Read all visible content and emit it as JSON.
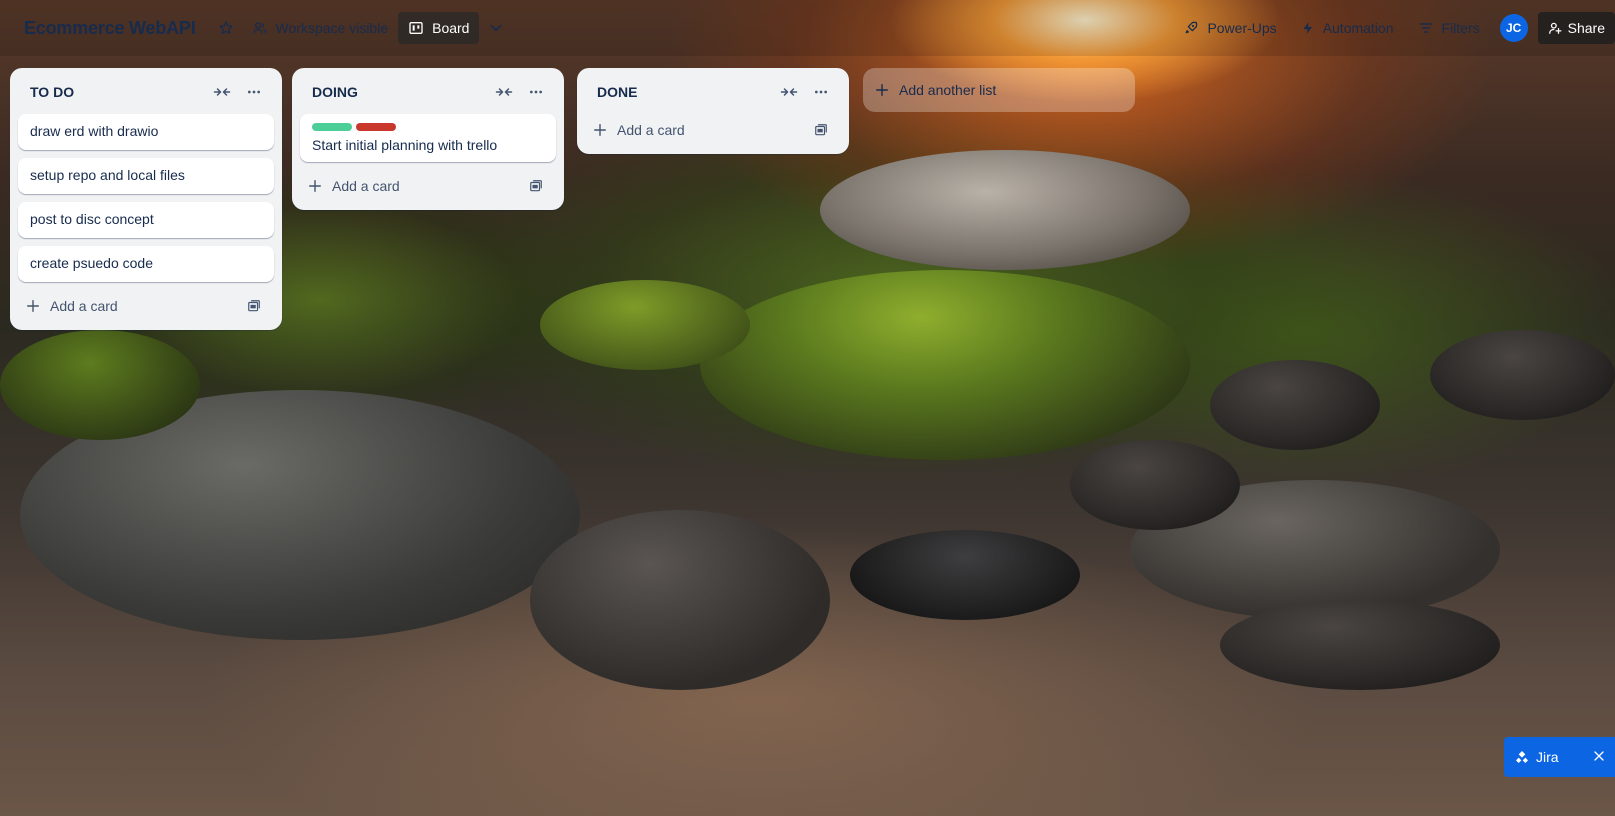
{
  "header": {
    "board_title": "Ecommerce WebAPI",
    "star_icon": "star-icon",
    "visibility_label": "Workspace visible",
    "view_label": "Board",
    "power_ups_label": "Power-Ups",
    "automation_label": "Automation",
    "filters_label": "Filters",
    "avatar_initials": "JC",
    "share_label": "Share"
  },
  "lists": [
    {
      "title": "TO DO",
      "cards": [
        {
          "text": "draw erd with drawio"
        },
        {
          "text": "setup repo and local files"
        },
        {
          "text": "post to disc concept"
        },
        {
          "text": "create psuedo code"
        }
      ],
      "add_card_label": "Add a card"
    },
    {
      "title": "DOING",
      "cards": [
        {
          "text": "Start initial planning with trello",
          "labels": [
            "#4bce97",
            "#c9372c"
          ]
        }
      ],
      "add_card_label": "Add a card"
    },
    {
      "title": "DONE",
      "cards": [],
      "add_card_label": "Add a card"
    }
  ],
  "add_list_label": "Add another list",
  "jira": {
    "label": "Jira",
    "close_icon": "close-icon"
  },
  "colors": {
    "accent": "#0c66e4",
    "list_bg": "#f1f2f4"
  }
}
